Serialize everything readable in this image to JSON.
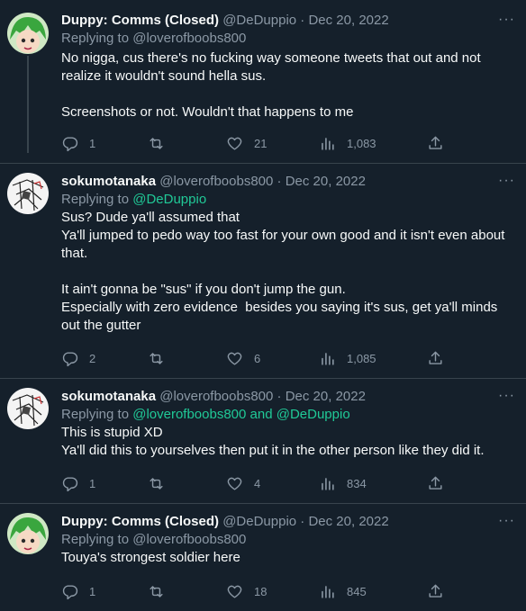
{
  "tweets": [
    {
      "name": "Duppy: Comms (Closed)",
      "handle": "@DeDuppio",
      "sep": "·",
      "date": "Dec 20, 2022",
      "reply_prefix": "Replying to",
      "reply_to": "@loverofboobs800",
      "reply_to_2": "",
      "text": "No nigga, cus there's no fucking way someone tweets that out and not realize it wouldn't sound hella sus.\n\nScreenshots or not. Wouldn't that happens to me",
      "replies": "1",
      "retweets": "",
      "likes": "21",
      "views": "1,083",
      "avatar": "green-hair-anime-avatar"
    },
    {
      "name": "sokumotanaka",
      "handle": "@loverofboobs800",
      "sep": "·",
      "date": "Dec 20, 2022",
      "reply_prefix": "Replying to",
      "reply_to": "@DeDuppio",
      "reply_to_2": "",
      "text": "Sus? Dude ya'll assumed that\nYa'll jumped to pedo way too fast for your own good and it isn't even about that.\n\nIt ain't gonna be \"sus\" if you don't jump the gun.\nEspecially with zero evidence  besides you saying it's sus, get ya'll minds out the gutter",
      "replies": "2",
      "retweets": "",
      "likes": "6",
      "views": "1,085",
      "avatar": "sketch-anime-avatar"
    },
    {
      "name": "sokumotanaka",
      "handle": "@loverofboobs800",
      "sep": "·",
      "date": "Dec 20, 2022",
      "reply_prefix": "Replying to",
      "reply_to": "@loverofboobs800 and @DeDuppio",
      "reply_to_2": "",
      "text": "This is stupid XD\nYa'll did this to yourselves then put it in the other person like they did it.",
      "replies": "1",
      "retweets": "",
      "likes": "4",
      "views": "834",
      "avatar": "sketch-anime-avatar"
    },
    {
      "name": "Duppy: Comms (Closed)",
      "handle": "@DeDuppio",
      "sep": "·",
      "date": "Dec 20, 2022",
      "reply_prefix": "Replying to",
      "reply_to": "@loverofboobs800",
      "reply_to_2": "",
      "text": "Touya's strongest soldier here",
      "replies": "1",
      "retweets": "",
      "likes": "18",
      "views": "845",
      "avatar": "green-hair-anime-avatar"
    }
  ],
  "more_label": "···",
  "colors": {
    "background": "#15202b",
    "muted": "#8b98a5",
    "link": "#1d9bf0",
    "green": "#20c997"
  }
}
